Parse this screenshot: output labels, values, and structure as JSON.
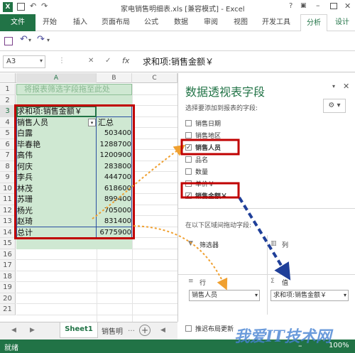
{
  "window": {
    "title": "家电销售明细表.xls [兼容模式] - Excel"
  },
  "ribbon": {
    "file": "文件",
    "tabs": [
      "开始",
      "插入",
      "页面布局",
      "公式",
      "数据",
      "审阅",
      "视图",
      "开发工具",
      "分析",
      "设计"
    ]
  },
  "formula_bar": {
    "cell_ref": "A3",
    "cancel": "✕",
    "enter": "✓",
    "fx": "fx",
    "content": "求和项:销售金额￥"
  },
  "grid": {
    "columns": [
      "A",
      "B",
      "C"
    ],
    "row_numbers": [
      "1",
      "2",
      "3",
      "4",
      "5",
      "6",
      "7",
      "8",
      "9",
      "10",
      "11",
      "12",
      "13",
      "14",
      "15",
      "16",
      "17",
      "18",
      "19",
      "20",
      "21"
    ],
    "placeholder": "将报表筛选字段拖至此处",
    "pivot_header": "求和项:销售金额￥",
    "row_label": "销售人员",
    "total_label": "汇总",
    "rows": [
      {
        "name": "白露",
        "value": "503400"
      },
      {
        "name": "毕春艳",
        "value": "1288700"
      },
      {
        "name": "高伟",
        "value": "1200900"
      },
      {
        "name": "何庆",
        "value": "283800"
      },
      {
        "name": "李兵",
        "value": "444700"
      },
      {
        "name": "林茂",
        "value": "618600"
      },
      {
        "name": "苏珊",
        "value": "899400"
      },
      {
        "name": "杨光",
        "value": "705000"
      },
      {
        "name": "赵琦",
        "value": "831400"
      }
    ],
    "grand_total_label": "总计",
    "grand_total": "6775900"
  },
  "pane": {
    "title": "数据透视表字段",
    "subtitle": "选择要添加到报表的字段:",
    "fields": [
      {
        "label": "销售日期",
        "checked": false
      },
      {
        "label": "销售地区",
        "checked": false
      },
      {
        "label": "销售人员",
        "checked": true
      },
      {
        "label": "品名",
        "checked": false
      },
      {
        "label": "数量",
        "checked": false
      },
      {
        "label": "单价￥",
        "checked": false
      },
      {
        "label": "销售金额￥",
        "checked": true
      }
    ],
    "drag_hint": "在以下区域间拖动字段:",
    "filters_label": "筛选器",
    "columns_label": "列",
    "rows_label": "行",
    "values_label": "值",
    "rows_field": "销售人员",
    "values_field": "求和项:销售金额￥",
    "defer": "推迟布局更新"
  },
  "sheets": {
    "active": "Sheet1",
    "other": "销售明"
  },
  "status": {
    "ready": "就绪",
    "zoom": "100%"
  },
  "watermark": "我爱IT技术网",
  "colors": {
    "excel_green": "#217346",
    "pivot_fill": "#cfe8d2",
    "highlight_red": "#c00000",
    "arrow_orange": "#f0a030",
    "arrow_blue": "#1f3f99"
  }
}
